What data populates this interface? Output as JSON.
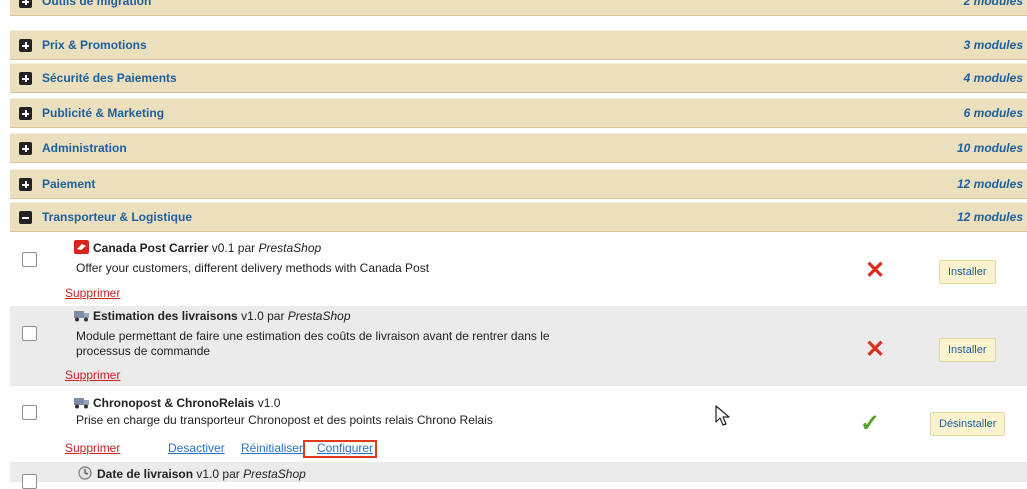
{
  "categories": [
    {
      "name": "Outils de migration",
      "count": "2 modules",
      "state": "collapsed"
    },
    {
      "name": "Prix & Promotions",
      "count": "3 modules",
      "state": "collapsed"
    },
    {
      "name": "Sécurité des Paiements",
      "count": "4 modules",
      "state": "collapsed"
    },
    {
      "name": "Publicité & Marketing",
      "count": "6 modules",
      "state": "collapsed"
    },
    {
      "name": "Administration",
      "count": "10 modules",
      "state": "collapsed"
    },
    {
      "name": "Paiement",
      "count": "12 modules",
      "state": "collapsed"
    },
    {
      "name": "Transporteur & Logistique",
      "count": "12 modules",
      "state": "expanded"
    }
  ],
  "modules": [
    {
      "name": "Canada Post Carrier",
      "version": "v0.1",
      "by": "par",
      "author": "PrestaShop",
      "icon": "canada-post-icon",
      "description": "Offer your customers, different delivery methods with Canada Post",
      "delete_label": "Supprimer",
      "status": "not-installed",
      "action_label": "Installer"
    },
    {
      "name": "Estimation des livraisons",
      "version": "v1.0",
      "by": "par",
      "author": "PrestaShop",
      "icon": "truck-icon",
      "description_line1": "Module permettant de faire une estimation des coûts de livraison avant de rentrer dans le",
      "description_line2": "processus de commande",
      "delete_label": "Supprimer",
      "status": "not-installed",
      "action_label": "Installer"
    },
    {
      "name": "Chronopost & ChronoRelais",
      "version": "v1.0",
      "icon": "truck-icon",
      "description": "Prise en charge du transporteur Chronopost et des points relais Chrono Relais",
      "delete_label": "Supprimer",
      "deactivate_label": "Desactiver",
      "reset_label": "Réinitialiser",
      "configure_label": "Configurer",
      "status": "installed",
      "action_label": "Désinstaller"
    },
    {
      "name": "Date de livraison",
      "version": "v1.0",
      "by": "par",
      "author": "PrestaShop",
      "icon": "clock-icon"
    }
  ],
  "colors": {
    "category_bg": "#ecdfbd",
    "link_blue": "#1d5f9e",
    "delete_red": "#cc2222",
    "status_red": "#d4301d",
    "status_green": "#5aa02c",
    "highlight": "#e03b1b"
  }
}
